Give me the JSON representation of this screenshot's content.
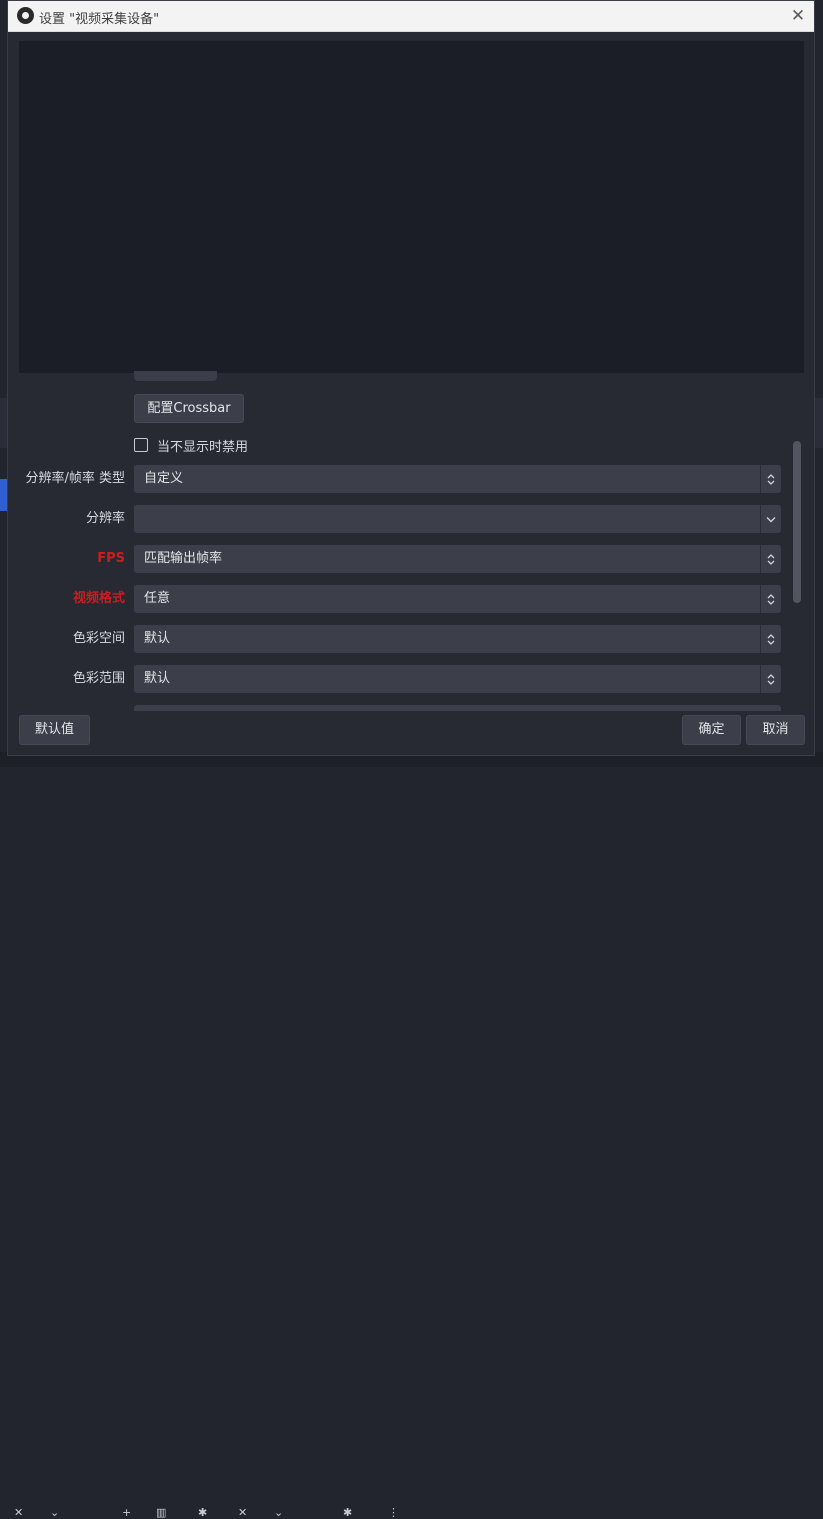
{
  "window": {
    "title": "设置 \"视频采集设备\""
  },
  "properties": {
    "crossbar_button": "配置Crossbar",
    "deactivate_checkbox": {
      "label": "当不显示时禁用",
      "checked": false
    },
    "rows": [
      {
        "label": "分辨率/帧率 类型",
        "value": "自定义",
        "highlight": false
      },
      {
        "label": "分辨率",
        "value": "",
        "highlight": false
      },
      {
        "label": "FPS",
        "value": "匹配输出帧率",
        "highlight": true
      },
      {
        "label": "视频格式",
        "value": "任意",
        "highlight": true
      },
      {
        "label": "色彩空间",
        "value": "默认",
        "highlight": false
      },
      {
        "label": "色彩范围",
        "value": "默认",
        "highlight": false
      }
    ]
  },
  "footer": {
    "defaults_button": "默认值",
    "ok_button": "确定",
    "cancel_button": "取消"
  },
  "colors": {
    "highlight_label": "#c81e1e",
    "dialog_bg": "#272a33",
    "control_bg": "#3c3f4a"
  },
  "icons": {
    "title": "obs-logo-icon",
    "close": "close-icon",
    "select_spin": "updown-chevron-icon",
    "select_dropdown": "chevron-down-icon"
  }
}
